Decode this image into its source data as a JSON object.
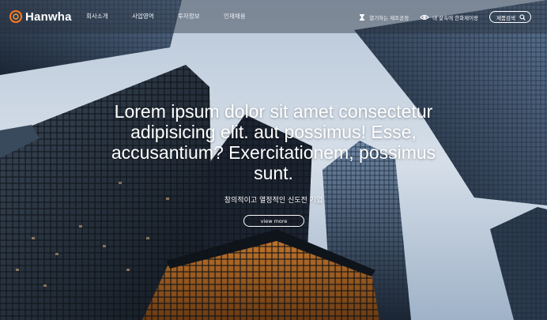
{
  "brand": {
    "name": "Hanwha",
    "accent": "#f37321"
  },
  "nav": {
    "items": [
      {
        "label": "회사소개"
      },
      {
        "label": "사업영역"
      },
      {
        "label": "투자정보"
      },
      {
        "label": "인재채용"
      }
    ]
  },
  "utilities": {
    "factory_tour": {
      "icon": "hourglass-icon",
      "label": "열기하는 제조공정"
    },
    "view_store": {
      "icon": "eye-icon",
      "label": "내 삶속에 한화제이랑"
    },
    "product_button": {
      "label": "제품검색",
      "icon": "search-icon"
    }
  },
  "hero": {
    "headline": "Lorem ipsum dolor sit amet consectetur adipisicing elit. aut possimus! Esse, accusantium? Exercitationem, possimus sunt.",
    "subline": "창의적이고 열정적인 신도전 기업",
    "view_more": "view more"
  }
}
